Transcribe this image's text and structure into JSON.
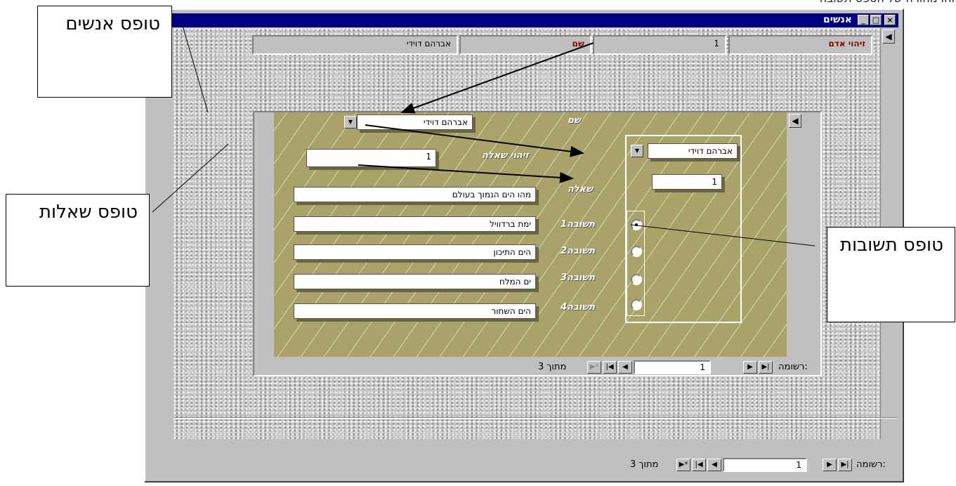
{
  "top_caption": "זהו מהורה של הספט תשובה",
  "window": {
    "title": "אנשים",
    "controls": {
      "min": "_",
      "max": "□",
      "close": "×"
    }
  },
  "main_form": {
    "person_id_label": "זיהוי אדם",
    "person_id_value": "1",
    "name_label": "שם",
    "name_value": "אברהם דוידי"
  },
  "questions_subform": {
    "name_label": "שם",
    "name_value": "אברהם דוידי",
    "question_id_label": "זיהוי שאלה",
    "question_id_value": "1",
    "question_label": "שאלה",
    "question_value": "מהו הים הנמוך בעולם",
    "answers": [
      {
        "label": "תשובה1",
        "value": "ימת ברדוויל"
      },
      {
        "label": "תשובה2",
        "value": "הים התיכון"
      },
      {
        "label": "תשובה3",
        "value": "ים המלח"
      },
      {
        "label": "תשובה4",
        "value": "הים השחור"
      }
    ]
  },
  "answers_subform": {
    "name_value": "אברהם דוידי",
    "id_value": "1",
    "selected_index": 0
  },
  "sub_nav": {
    "label": "רשומה:",
    "current": "1",
    "total_text": "מתוך 3"
  },
  "main_nav": {
    "label": "רשומה:",
    "current": "1",
    "total_text": "מתוך 3"
  },
  "callouts": {
    "people": "טופס אנשים",
    "questions": "טופס שאלות",
    "answers": "טופס תשובות"
  }
}
